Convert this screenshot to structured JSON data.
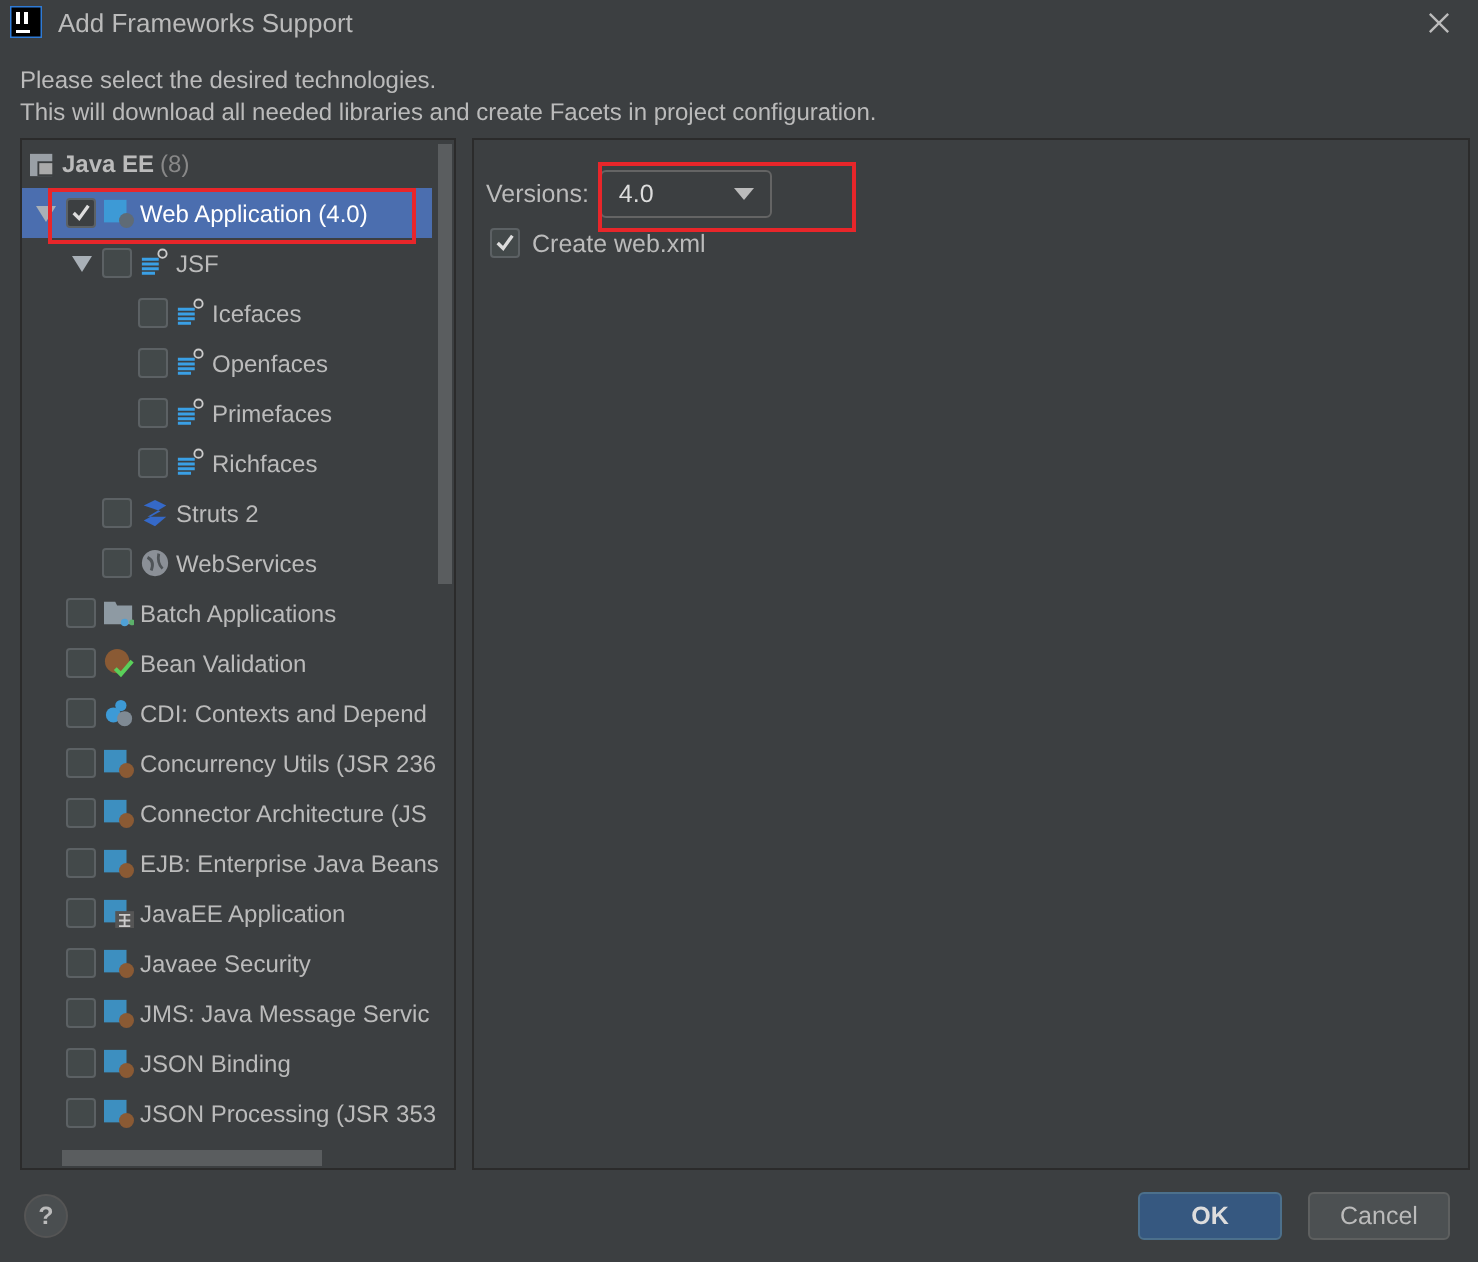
{
  "window": {
    "title": "Add Frameworks Support"
  },
  "description": [
    "Please select the desired technologies.",
    "This will download all needed libraries and create Facets in project configuration."
  ],
  "tree": {
    "group": {
      "label": "Java EE",
      "count": "(8)"
    },
    "items": [
      {
        "label": "Web Application (4.0)",
        "kind": "web",
        "checked": true,
        "selected": true,
        "expanded": true,
        "children": [
          {
            "label": "JSF",
            "kind": "jsf",
            "checked": false,
            "selected": false,
            "expanded": true,
            "children": [
              {
                "label": "Icefaces",
                "kind": "jsf",
                "checked": false,
                "selected": false
              },
              {
                "label": "Openfaces",
                "kind": "jsf",
                "checked": false,
                "selected": false
              },
              {
                "label": "Primefaces",
                "kind": "jsf",
                "checked": false,
                "selected": false
              },
              {
                "label": "Richfaces",
                "kind": "jsf",
                "checked": false,
                "selected": false
              }
            ]
          },
          {
            "label": "Struts 2",
            "kind": "struts",
            "checked": false,
            "selected": false
          },
          {
            "label": "WebServices",
            "kind": "globe",
            "checked": false,
            "selected": false
          }
        ]
      },
      {
        "label": "Batch Applications",
        "kind": "folder",
        "checked": false,
        "selected": false
      },
      {
        "label": "Bean Validation",
        "kind": "bean",
        "checked": false,
        "selected": false
      },
      {
        "label": "CDI: Contexts and Depend",
        "kind": "cdi",
        "checked": false,
        "selected": false
      },
      {
        "label": "Concurrency Utils (JSR 236",
        "kind": "module",
        "checked": false,
        "selected": false
      },
      {
        "label": "Connector Architecture (JS",
        "kind": "module",
        "checked": false,
        "selected": false
      },
      {
        "label": "EJB: Enterprise Java Beans",
        "kind": "module",
        "checked": false,
        "selected": false
      },
      {
        "label": "JavaEE Application",
        "kind": "javaee",
        "checked": false,
        "selected": false
      },
      {
        "label": "Javaee Security",
        "kind": "module",
        "checked": false,
        "selected": false
      },
      {
        "label": "JMS: Java Message Servic",
        "kind": "module",
        "checked": false,
        "selected": false
      },
      {
        "label": "JSON Binding",
        "kind": "module",
        "checked": false,
        "selected": false
      },
      {
        "label": "JSON Processing (JSR 353",
        "kind": "module",
        "checked": false,
        "selected": false
      }
    ]
  },
  "settings": {
    "versions_label": "Versions:",
    "version": "4.0",
    "create_web_xml": {
      "label": "Create web.xml",
      "checked": true
    }
  },
  "buttons": {
    "help": "?",
    "ok": "OK",
    "cancel": "Cancel"
  }
}
